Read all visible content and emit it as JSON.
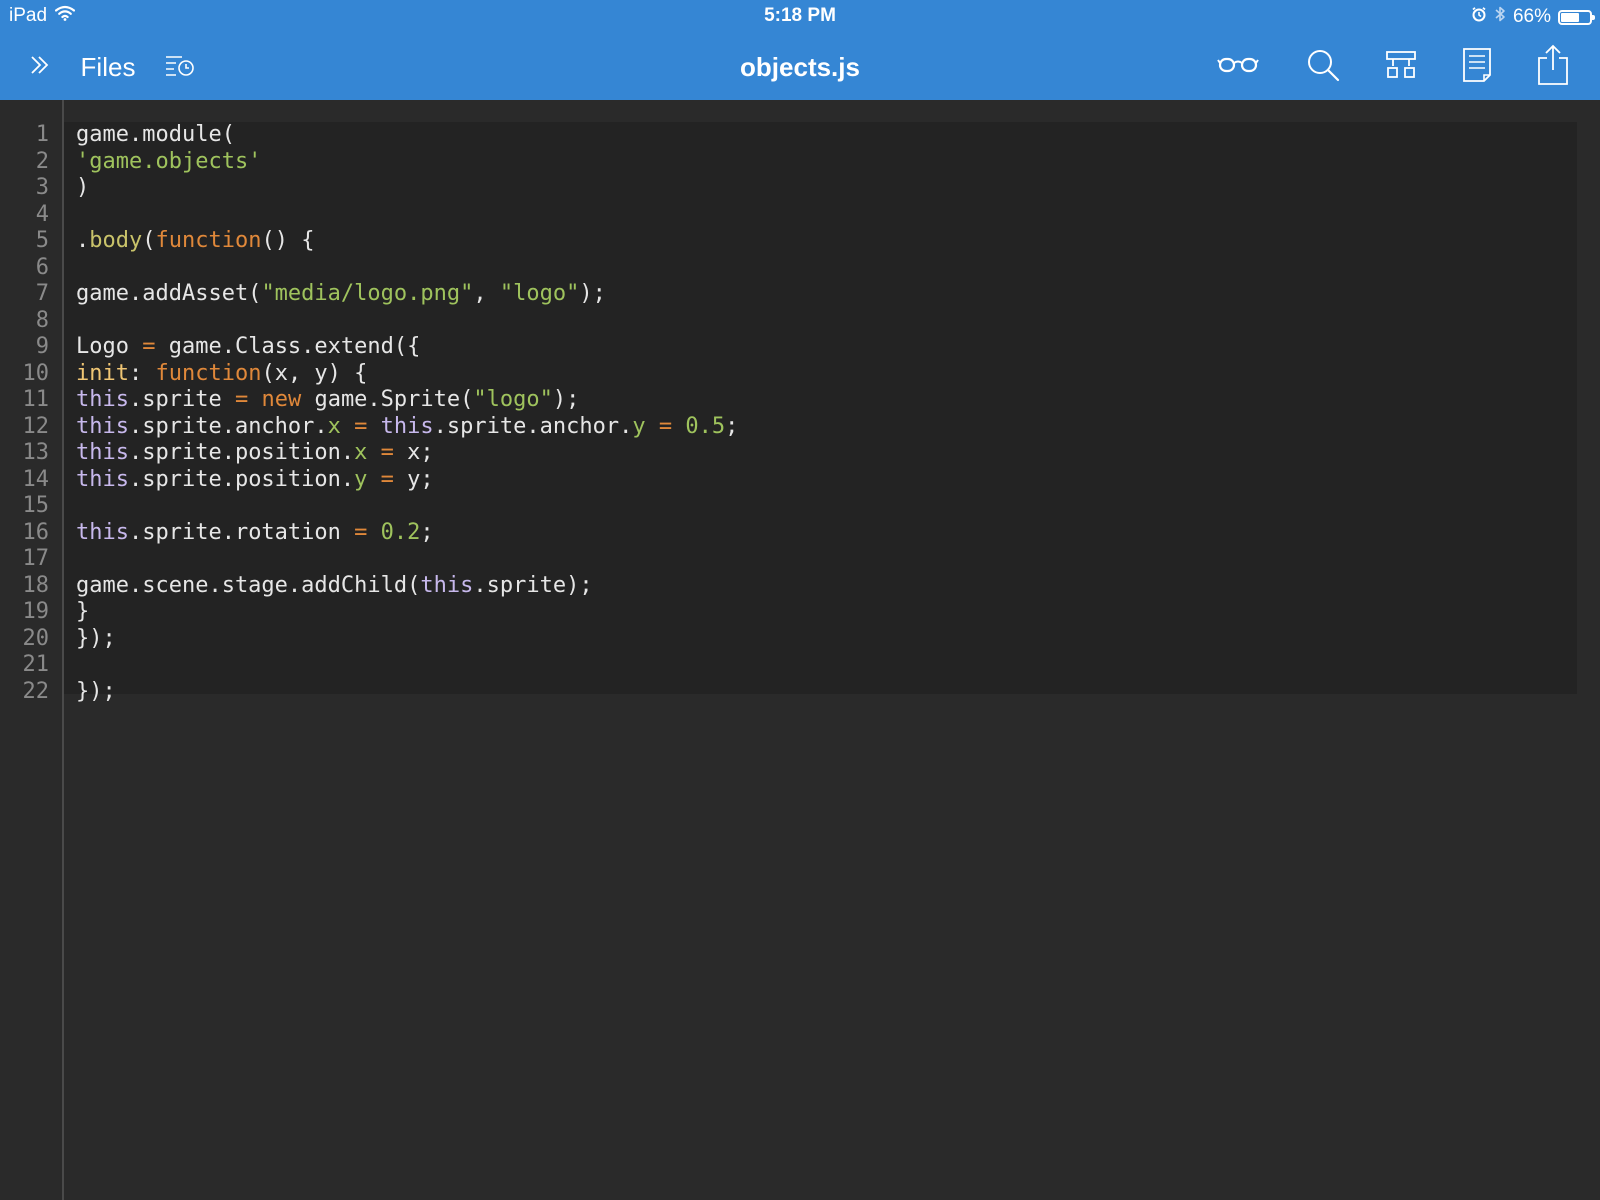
{
  "status_bar": {
    "device": "iPad",
    "time": "5:18 PM",
    "battery_percent": "66%",
    "battery_level": 0.66,
    "icons": [
      "wifi-icon",
      "alarm-icon",
      "bluetooth-icon",
      "battery-icon"
    ]
  },
  "nav": {
    "files_label": "Files",
    "title": "objects.js",
    "left_icons": [
      "expand-chevrons-icon",
      "recent-files-icon"
    ],
    "right_icons": [
      "reading-glasses-icon",
      "search-icon",
      "layout-icon",
      "document-icon",
      "share-icon"
    ]
  },
  "colors": {
    "header": "#3586d4",
    "editor_bg": "#2a2a2a",
    "code_bg": "#232323",
    "string": "#9fc35d",
    "keyword": "#e0883a",
    "this": "#c7b8ec"
  },
  "editor": {
    "lines": [
      {
        "n": "1",
        "tokens": [
          {
            "t": "game.module(",
            "k": "plain"
          }
        ]
      },
      {
        "n": "2",
        "tokens": [
          {
            "t": "'game.objects'",
            "k": "string"
          }
        ]
      },
      {
        "n": "3",
        "tokens": [
          {
            "t": ")",
            "k": "plain"
          }
        ]
      },
      {
        "n": "4",
        "tokens": []
      },
      {
        "n": "5",
        "tokens": [
          {
            "t": ".",
            "k": "plain"
          },
          {
            "t": "body",
            "k": "method"
          },
          {
            "t": "(",
            "k": "plain"
          },
          {
            "t": "function",
            "k": "keyword"
          },
          {
            "t": "() {",
            "k": "plain"
          }
        ]
      },
      {
        "n": "6",
        "tokens": []
      },
      {
        "n": "7",
        "tokens": [
          {
            "t": "game.addAsset(",
            "k": "plain"
          },
          {
            "t": "\"media/logo.png\"",
            "k": "string"
          },
          {
            "t": ", ",
            "k": "plain"
          },
          {
            "t": "\"logo\"",
            "k": "string"
          },
          {
            "t": ");",
            "k": "plain"
          }
        ]
      },
      {
        "n": "8",
        "tokens": []
      },
      {
        "n": "9",
        "tokens": [
          {
            "t": "Logo ",
            "k": "plain"
          },
          {
            "t": "=",
            "k": "op"
          },
          {
            "t": " game.Class.extend({",
            "k": "plain"
          }
        ]
      },
      {
        "n": "10",
        "tokens": [
          {
            "t": "init",
            "k": "label"
          },
          {
            "t": ": ",
            "k": "plain"
          },
          {
            "t": "function",
            "k": "keyword"
          },
          {
            "t": "(x, y) {",
            "k": "plain"
          }
        ]
      },
      {
        "n": "11",
        "tokens": [
          {
            "t": "this",
            "k": "this"
          },
          {
            "t": ".sprite ",
            "k": "plain"
          },
          {
            "t": "=",
            "k": "op"
          },
          {
            "t": " ",
            "k": "plain"
          },
          {
            "t": "new",
            "k": "keyword"
          },
          {
            "t": " game.Sprite(",
            "k": "plain"
          },
          {
            "t": "\"logo\"",
            "k": "string"
          },
          {
            "t": ");",
            "k": "plain"
          }
        ]
      },
      {
        "n": "12",
        "tokens": [
          {
            "t": "this",
            "k": "this"
          },
          {
            "t": ".sprite.anchor.",
            "k": "plain"
          },
          {
            "t": "x",
            "k": "prop"
          },
          {
            "t": " ",
            "k": "plain"
          },
          {
            "t": "=",
            "k": "op"
          },
          {
            "t": " ",
            "k": "plain"
          },
          {
            "t": "this",
            "k": "this"
          },
          {
            "t": ".sprite.anchor.",
            "k": "plain"
          },
          {
            "t": "y",
            "k": "prop"
          },
          {
            "t": " ",
            "k": "plain"
          },
          {
            "t": "=",
            "k": "op"
          },
          {
            "t": " ",
            "k": "plain"
          },
          {
            "t": "0.5",
            "k": "number"
          },
          {
            "t": ";",
            "k": "plain"
          }
        ]
      },
      {
        "n": "13",
        "tokens": [
          {
            "t": "this",
            "k": "this"
          },
          {
            "t": ".sprite.position.",
            "k": "plain"
          },
          {
            "t": "x",
            "k": "prop"
          },
          {
            "t": " ",
            "k": "plain"
          },
          {
            "t": "=",
            "k": "op"
          },
          {
            "t": " x;",
            "k": "plain"
          }
        ]
      },
      {
        "n": "14",
        "tokens": [
          {
            "t": "this",
            "k": "this"
          },
          {
            "t": ".sprite.position.",
            "k": "plain"
          },
          {
            "t": "y",
            "k": "prop"
          },
          {
            "t": " ",
            "k": "plain"
          },
          {
            "t": "=",
            "k": "op"
          },
          {
            "t": " y;",
            "k": "plain"
          }
        ]
      },
      {
        "n": "15",
        "tokens": []
      },
      {
        "n": "16",
        "tokens": [
          {
            "t": "this",
            "k": "this"
          },
          {
            "t": ".sprite.rotation ",
            "k": "plain"
          },
          {
            "t": "=",
            "k": "op"
          },
          {
            "t": " ",
            "k": "plain"
          },
          {
            "t": "0.2",
            "k": "number"
          },
          {
            "t": ";",
            "k": "plain"
          }
        ]
      },
      {
        "n": "17",
        "tokens": []
      },
      {
        "n": "18",
        "tokens": [
          {
            "t": "game.scene.stage.addChild(",
            "k": "plain"
          },
          {
            "t": "this",
            "k": "this"
          },
          {
            "t": ".sprite);",
            "k": "plain"
          }
        ]
      },
      {
        "n": "19",
        "tokens": [
          {
            "t": "}",
            "k": "plain"
          }
        ]
      },
      {
        "n": "20",
        "tokens": [
          {
            "t": "});",
            "k": "plain"
          }
        ]
      },
      {
        "n": "21",
        "tokens": []
      },
      {
        "n": "22",
        "tokens": [
          {
            "t": "});",
            "k": "plain"
          }
        ]
      }
    ]
  }
}
